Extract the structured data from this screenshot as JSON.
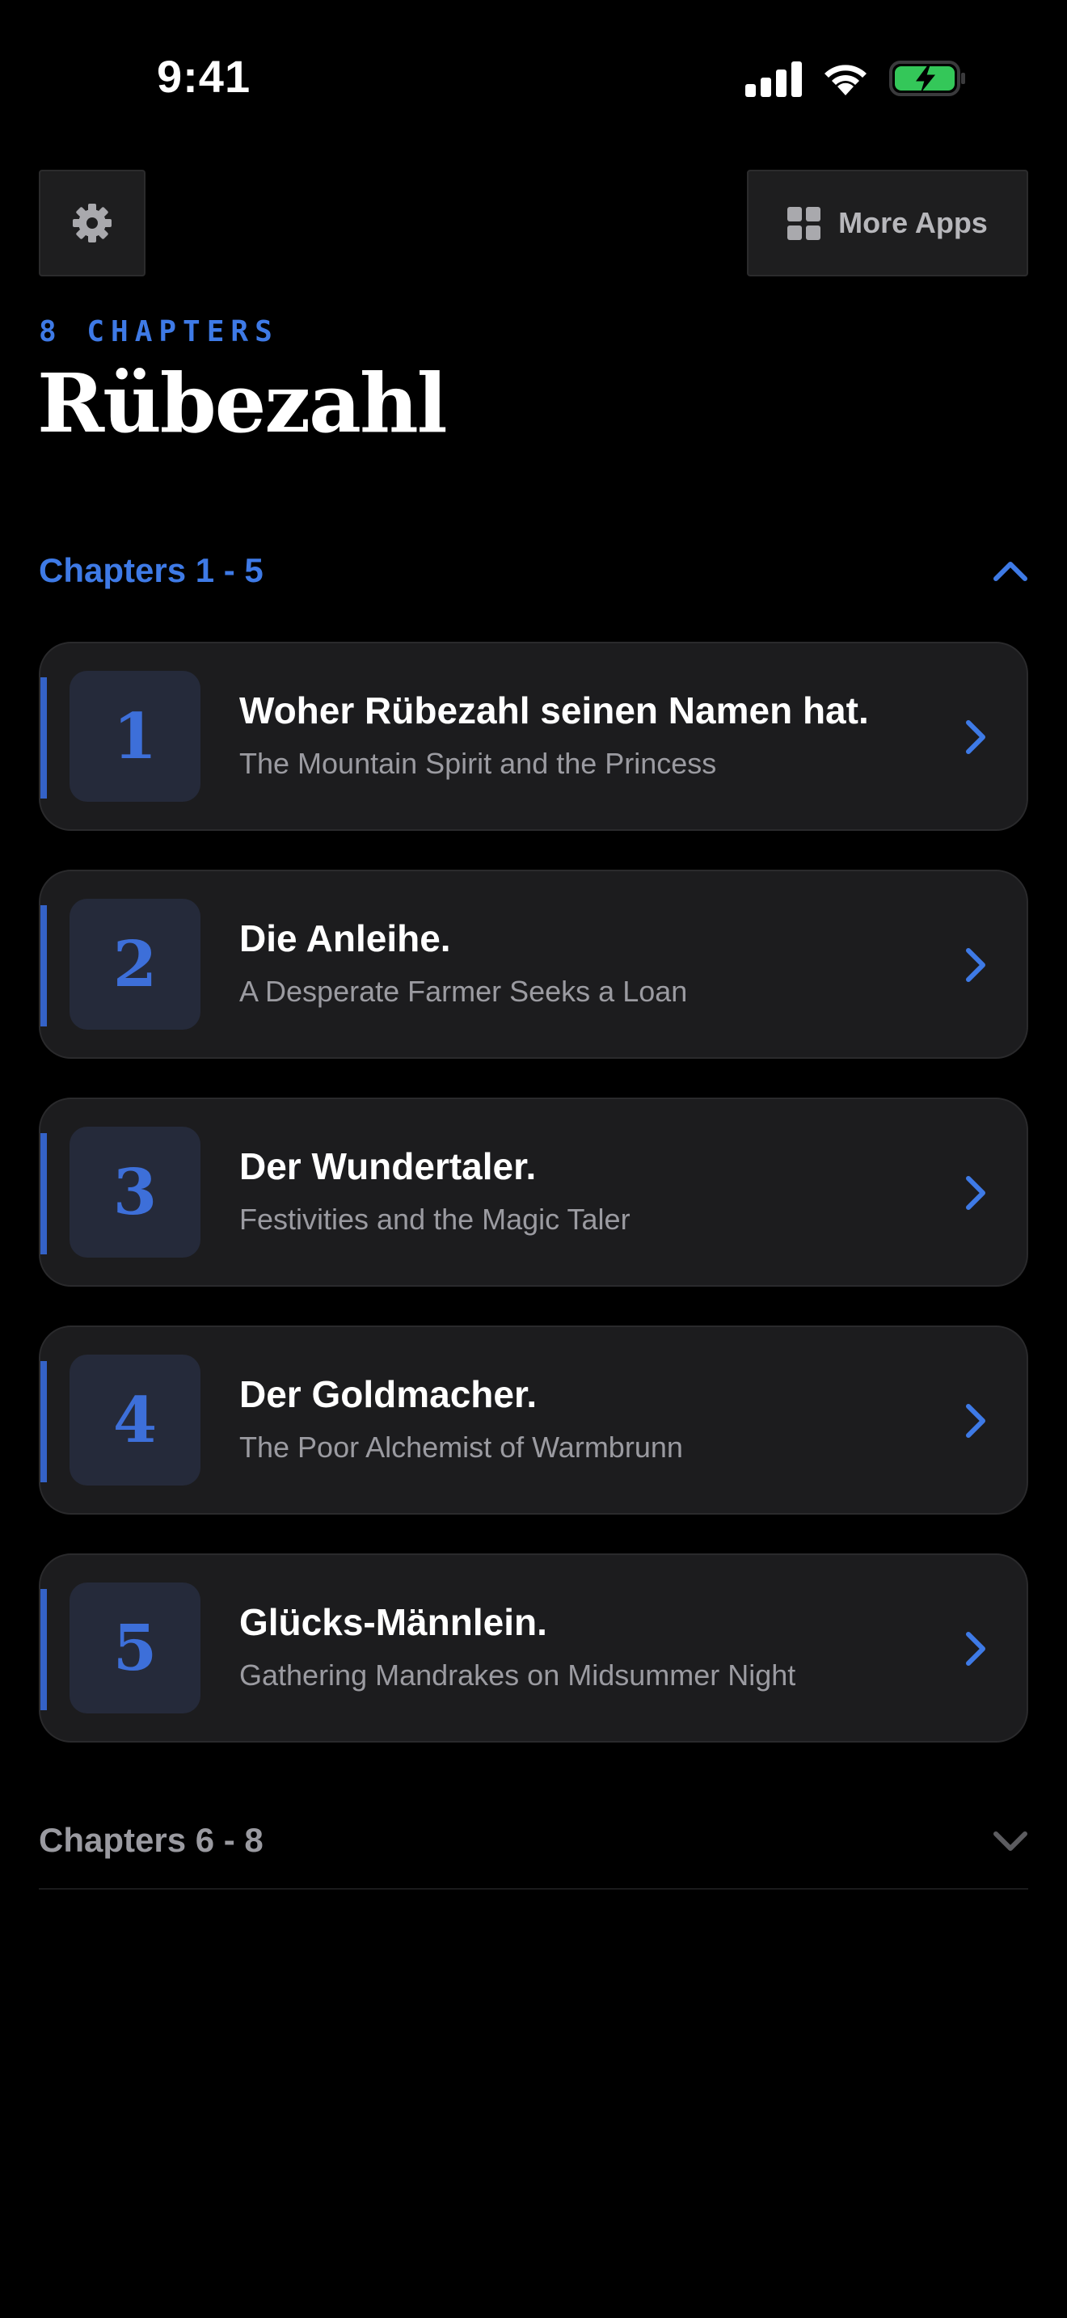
{
  "status_bar": {
    "time": "9:41"
  },
  "header": {
    "more_apps_label": "More Apps"
  },
  "book": {
    "chapter_count": "8 CHAPTERS",
    "title": "Rübezahl"
  },
  "sections": [
    {
      "label": "Chapters 1 - 5",
      "expanded": true,
      "chapters": [
        {
          "number": "1",
          "title": "Woher Rübezahl seinen Namen hat.",
          "subtitle": "The Mountain Spirit and the Princess"
        },
        {
          "number": "2",
          "title": "Die Anleihe.",
          "subtitle": "A Desperate Farmer Seeks a Loan"
        },
        {
          "number": "3",
          "title": "Der Wundertaler.",
          "subtitle": "Festivities and the Magic Taler"
        },
        {
          "number": "4",
          "title": "Der Goldmacher.",
          "subtitle": "The Poor Alchemist of Warmbrunn"
        },
        {
          "number": "5",
          "title": "Glücks-Männlein.",
          "subtitle": "Gathering Mandrakes on Midsummer Night"
        }
      ]
    },
    {
      "label": "Chapters 6 - 8",
      "expanded": false
    }
  ],
  "colors": {
    "accent": "#3e7ae6",
    "card_bg": "#1c1c1e",
    "battery_green": "#34c759"
  },
  "icons": [
    "signal-icon",
    "wifi-icon",
    "battery-charging-icon",
    "gear-icon",
    "grid-icon",
    "chevron-up-icon",
    "chevron-right-icon",
    "chevron-down-icon"
  ]
}
